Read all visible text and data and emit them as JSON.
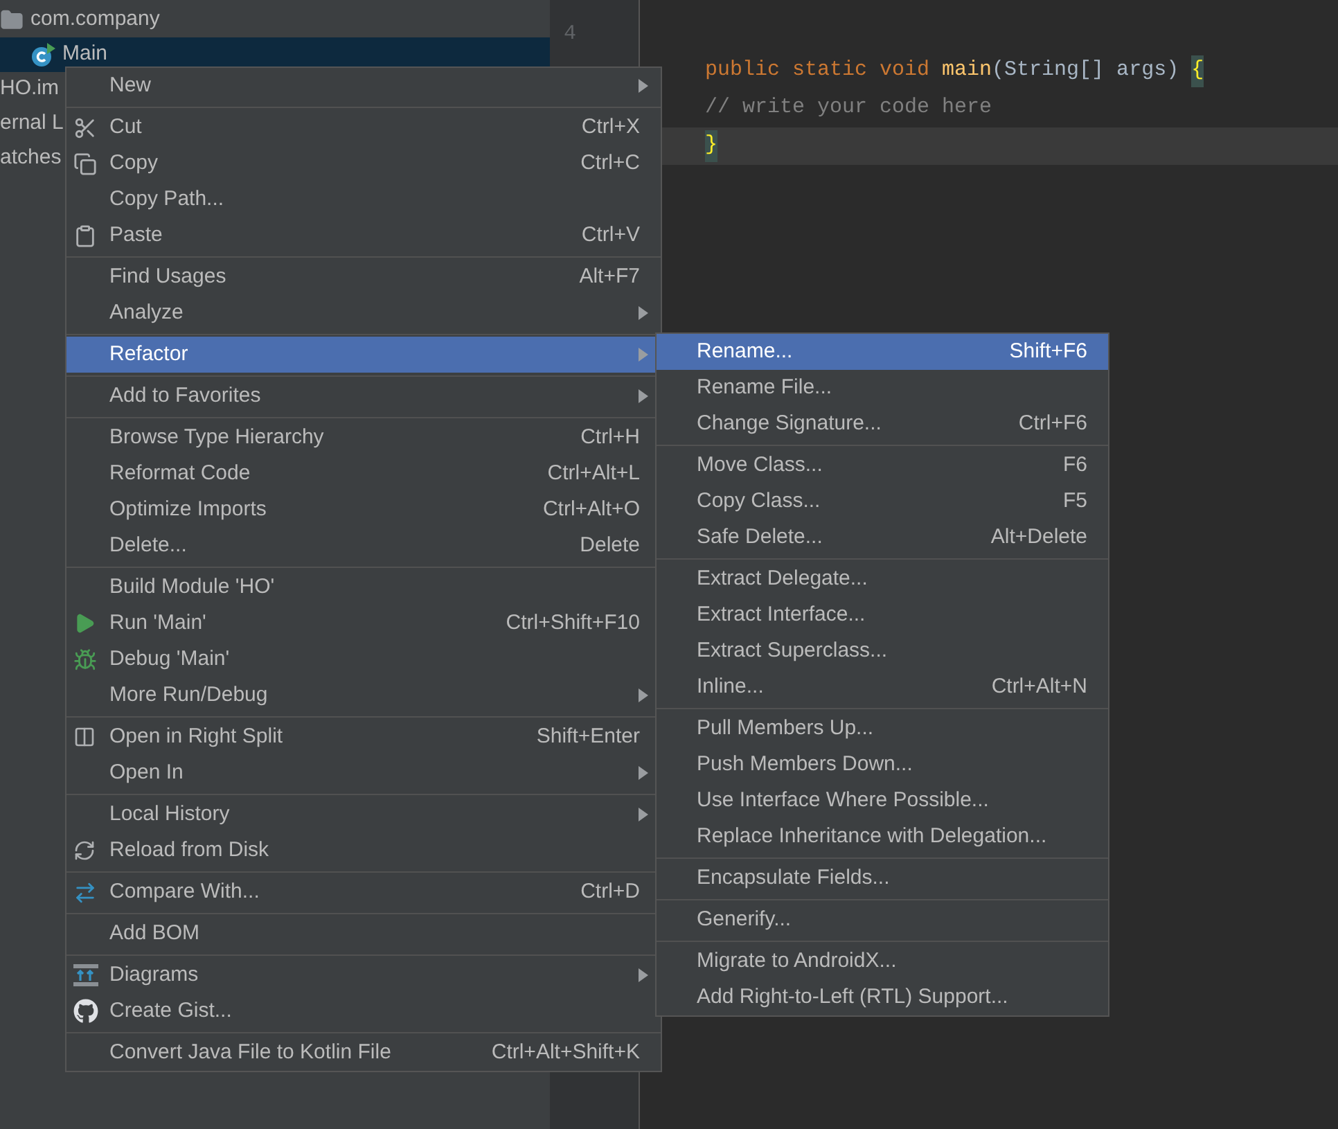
{
  "project_tree": {
    "items": [
      {
        "label": "com.company",
        "kind": "package",
        "selected": false
      },
      {
        "label": "Main",
        "kind": "class",
        "selected": true
      },
      {
        "label": "HO.im",
        "kind": "file",
        "selected": false
      },
      {
        "label": "ernal L",
        "kind": "file",
        "selected": false
      },
      {
        "label": "atches",
        "kind": "file",
        "selected": false
      }
    ]
  },
  "editor": {
    "line_numbers": [
      "4"
    ],
    "lines": [
      {
        "current": false,
        "tokens": [
          {
            "kind": "keyword",
            "text": "public static void "
          },
          {
            "kind": "function",
            "text": "main"
          },
          {
            "kind": "plain",
            "text": "(String[] args) "
          },
          {
            "kind": "brace_match",
            "text": "{"
          }
        ]
      },
      {
        "current": false,
        "tokens": [
          {
            "kind": "comment",
            "text": "// write your code here"
          }
        ]
      },
      {
        "current": true,
        "tokens": [
          {
            "kind": "brace_match",
            "text": "}"
          }
        ]
      }
    ]
  },
  "context_menu": {
    "groups": [
      [
        {
          "label": "New",
          "submenu": true,
          "selected": false
        }
      ],
      [
        {
          "label": "Cut",
          "shortcut": "Ctrl+X",
          "submenu": false,
          "selected": false
        },
        {
          "label": "Copy",
          "shortcut": "Ctrl+C",
          "submenu": false,
          "selected": false
        },
        {
          "label": "Copy Path...",
          "submenu": false,
          "selected": false
        },
        {
          "label": "Paste",
          "shortcut": "Ctrl+V",
          "submenu": false,
          "selected": false
        }
      ],
      [
        {
          "label": "Find Usages",
          "shortcut": "Alt+F7",
          "submenu": false,
          "selected": false
        },
        {
          "label": "Analyze",
          "submenu": true,
          "selected": false
        }
      ],
      [
        {
          "label": "Refactor",
          "submenu": true,
          "selected": true
        }
      ],
      [
        {
          "label": "Add to Favorites",
          "submenu": true,
          "selected": false
        }
      ],
      [
        {
          "label": "Browse Type Hierarchy",
          "shortcut": "Ctrl+H",
          "submenu": false,
          "selected": false
        },
        {
          "label": "Reformat Code",
          "shortcut": "Ctrl+Alt+L",
          "submenu": false,
          "selected": false
        },
        {
          "label": "Optimize Imports",
          "shortcut": "Ctrl+Alt+O",
          "submenu": false,
          "selected": false
        },
        {
          "label": "Delete...",
          "shortcut": "Delete",
          "submenu": false,
          "selected": false
        }
      ],
      [
        {
          "label": "Build Module 'HO'",
          "submenu": false,
          "selected": false
        },
        {
          "label": "Run 'Main'",
          "shortcut": "Ctrl+Shift+F10",
          "submenu": false,
          "selected": false
        },
        {
          "label": "Debug 'Main'",
          "submenu": false,
          "selected": false
        },
        {
          "label": "More Run/Debug",
          "submenu": true,
          "selected": false
        }
      ],
      [
        {
          "label": "Open in Right Split",
          "shortcut": "Shift+Enter",
          "submenu": false,
          "selected": false
        },
        {
          "label": "Open In",
          "submenu": true,
          "selected": false
        }
      ],
      [
        {
          "label": "Local History",
          "submenu": true,
          "selected": false
        },
        {
          "label": "Reload from Disk",
          "submenu": false,
          "selected": false
        }
      ],
      [
        {
          "label": "Compare With...",
          "shortcut": "Ctrl+D",
          "submenu": false,
          "selected": false
        }
      ],
      [
        {
          "label": "Add BOM",
          "submenu": false,
          "selected": false
        }
      ],
      [
        {
          "label": "Diagrams",
          "submenu": true,
          "selected": false
        },
        {
          "label": "Create Gist...",
          "submenu": false,
          "selected": false
        }
      ],
      [
        {
          "label": "Convert Java File to Kotlin File",
          "shortcut": "Ctrl+Alt+Shift+K",
          "submenu": false,
          "selected": false
        }
      ]
    ]
  },
  "refactor_submenu": {
    "groups": [
      [
        {
          "label": "Rename...",
          "shortcut": "Shift+F6",
          "selected": true
        },
        {
          "label": "Rename File...",
          "selected": false
        },
        {
          "label": "Change Signature...",
          "shortcut": "Ctrl+F6",
          "selected": false
        }
      ],
      [
        {
          "label": "Move Class...",
          "shortcut": "F6",
          "selected": false
        },
        {
          "label": "Copy Class...",
          "shortcut": "F5",
          "selected": false
        },
        {
          "label": "Safe Delete...",
          "shortcut": "Alt+Delete",
          "selected": false
        }
      ],
      [
        {
          "label": "Extract Delegate...",
          "selected": false
        },
        {
          "label": "Extract Interface...",
          "selected": false
        },
        {
          "label": "Extract Superclass...",
          "selected": false
        },
        {
          "label": "Inline...",
          "shortcut": "Ctrl+Alt+N",
          "selected": false
        }
      ],
      [
        {
          "label": "Pull Members Up...",
          "selected": false
        },
        {
          "label": "Push Members Down...",
          "selected": false
        },
        {
          "label": "Use Interface Where Possible...",
          "selected": false
        },
        {
          "label": "Replace Inheritance with Delegation...",
          "selected": false
        }
      ],
      [
        {
          "label": "Encapsulate Fields...",
          "selected": false
        }
      ],
      [
        {
          "label": "Generify...",
          "selected": false
        }
      ],
      [
        {
          "label": "Migrate to AndroidX...",
          "selected": false
        },
        {
          "label": "Add Right-to-Left (RTL) Support...",
          "selected": false
        }
      ]
    ]
  }
}
